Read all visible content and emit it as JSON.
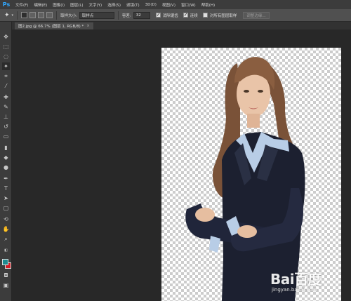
{
  "app": {
    "logo": "Ps"
  },
  "menu": [
    "文件(F)",
    "编辑(E)",
    "图像(I)",
    "图层(L)",
    "文字(Y)",
    "选择(S)",
    "滤镜(T)",
    "3D(D)",
    "视图(V)",
    "窗口(W)",
    "帮助(H)"
  ],
  "options": {
    "sample_size_label": "取样大小:",
    "sample_size_value": "取样点",
    "tolerance_label": "容差:",
    "tolerance_value": "32",
    "antialias_label": "消除锯齿",
    "contiguous_label": "连续",
    "sample_all_label": "对所有图层取样",
    "refine_edge_label": "调整边缘..."
  },
  "document": {
    "tab_label": "图2.jpg @ 66.7% (图层 1, RGB/8) *",
    "close_symbol": "×"
  },
  "colors": {
    "foreground": "#1d8a8f",
    "background": "#d11b22"
  },
  "watermark": {
    "logo": "Bai百度",
    "url": "jingyan.baidu.com"
  }
}
